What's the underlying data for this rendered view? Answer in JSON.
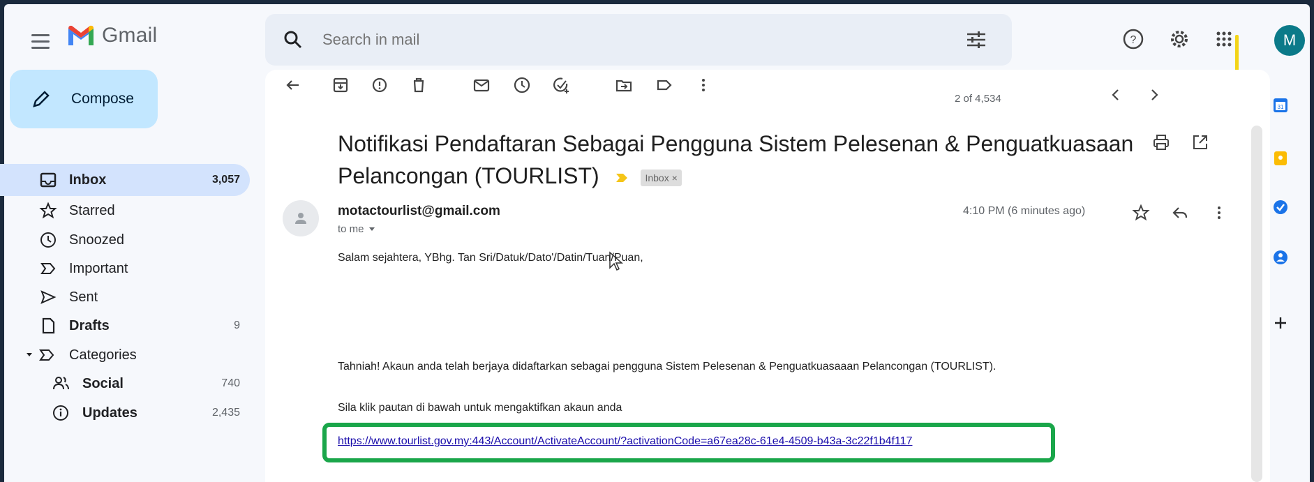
{
  "app": {
    "name": "Gmail"
  },
  "search": {
    "placeholder": "Search in mail"
  },
  "account": {
    "initial": "M"
  },
  "compose": {
    "label": "Compose"
  },
  "sidebar": {
    "items": [
      {
        "label": "Inbox",
        "count": "3,057"
      },
      {
        "label": "Starred",
        "count": ""
      },
      {
        "label": "Snoozed",
        "count": ""
      },
      {
        "label": "Important",
        "count": ""
      },
      {
        "label": "Sent",
        "count": ""
      },
      {
        "label": "Drafts",
        "count": "9"
      },
      {
        "label": "Categories",
        "count": ""
      },
      {
        "label": "Social",
        "count": "740"
      },
      {
        "label": "Updates",
        "count": "2,435"
      }
    ]
  },
  "pager": {
    "text": "2 of 4,534"
  },
  "email": {
    "subject": "Notifikasi Pendaftaran Sebagai Pengguna Sistem Pelesenan & Penguatkuasaan Pelancongan (TOURLIST)",
    "label_chip": "Inbox ×",
    "sender": "motactourlist@gmail.com",
    "to": "to me",
    "time": "4:10 PM (6 minutes ago)",
    "greeting": "Salam sejahtera, YBhg. Tan Sri/Datuk/Dato'/Datin/Tuan/Puan,",
    "paragraph1": "Tahniah! Akaun anda telah berjaya didaftarkan sebagai pengguna Sistem Pelesenan & Penguatkuasaaan Pelancongan (TOURLIST).",
    "paragraph2": "Sila klik pautan di bawah untuk mengaktifkan akaun anda",
    "link": "https://www.tourlist.gov.my:443/Account/ActivateAccount/?activationCode=a67ea28c-61e4-4509-b43a-3c22f1b4f117"
  },
  "colors": {
    "highlight_box": "#1aa64a",
    "highlight_bar": "#f3d417",
    "avatar_bg": "#0b7a89",
    "compose_bg": "#c2e7ff",
    "active_item_bg": "#d3e3fd"
  }
}
